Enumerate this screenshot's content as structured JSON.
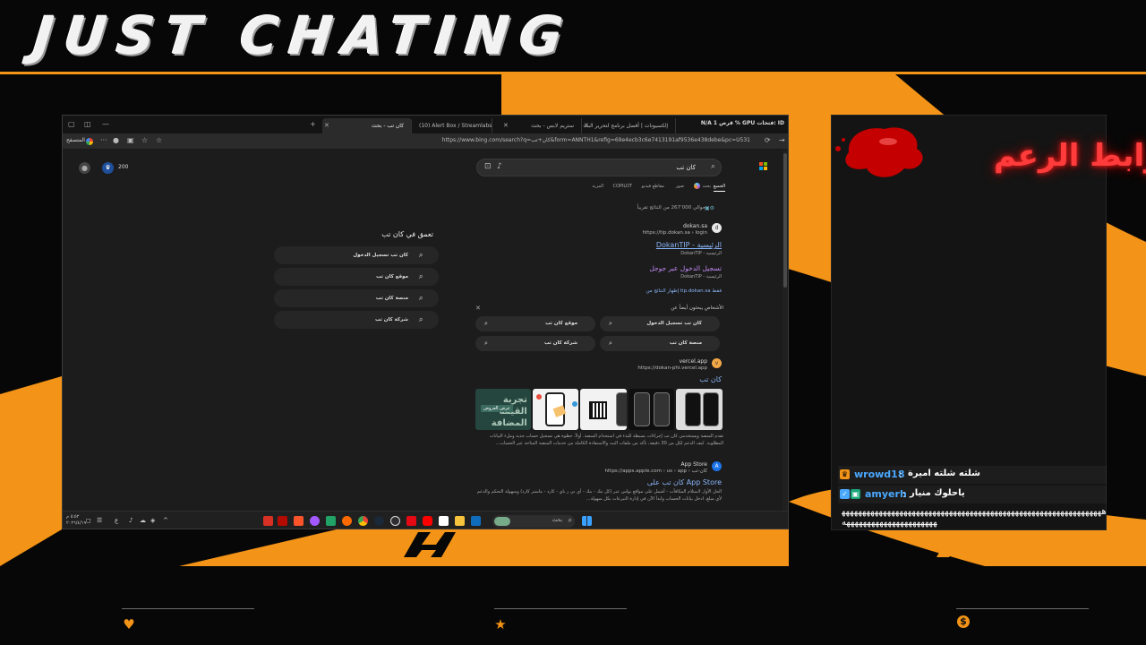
{
  "overlay": {
    "title": "JUST CHATING",
    "colors": {
      "accent": "#f39317",
      "frame": "#070707",
      "chat_name": "#4aa8ff",
      "neon": "#ff3b3b"
    },
    "footer_icons": [
      "heart-icon",
      "star-icon",
      "dollar-coin-icon"
    ],
    "dollar_symbol": "$"
  },
  "browser": {
    "tabs": [
      {
        "label": "كان تب - بحث",
        "active": true
      },
      {
        "label": "(10) Alert Box / Streamlabs",
        "active": false
      },
      {
        "label": "ستريم لابس - بحث",
        "active": false
      },
      {
        "label": "إلكسيونات | أفضل برنامج لتحرير البث",
        "active": false
      }
    ],
    "system_info": "N/A  قرص 1 % GPU فتحات: ID",
    "mode_label": "المتصفح",
    "url": "https://www.bing.com/search?q=كان+تب&form=ANNTH1&refig=69e4ecb3c6e7413191af9536e438debe&pc=U531"
  },
  "page": {
    "points": "200",
    "search_query": "كان تب",
    "scope_tabs": [
      "الجميع",
      "بحث",
      "صور",
      "مقاطع فيديو",
      "COPILOT",
      "المزيد"
    ],
    "results_count": "حوالي 267٬000 من النتائج تقريباً",
    "results": [
      {
        "favicon": "d",
        "site": "dokan.sa",
        "url": "https://tip.dokan.sa › login",
        "title": "DokanTIP - الرئيسية",
        "sub": "DokanTIP - الرئيسية",
        "title2": "تسجيل الدخول عبر جوجل",
        "sub2": "DokanTIP - الرئيسية",
        "show_all": "إظهار النتائج من tip.dokan.sa فقط"
      },
      {
        "favicon": "v",
        "site": "vercel.app",
        "url": "https://dokan-phi.vercel.app",
        "title": "كان تب",
        "snippet": "تقدم المنصة ويستخدمي كان تب إجراءات بسيطة للبدء في استخدام المنصة. أولاً، خطوة هي تسجيل حساب جديد وملء البيانات المطلوبة. كيف الدعم لكل من 30 دقيقة، تأكد من ملفات البث والاستفادة الكاملة من خدمات المنصة المتاحة عبر الحساب..."
      },
      {
        "favicon": "A",
        "site": "App Store",
        "url": "https://apps.apple.com › us › app › كان-تب",
        "title": "كان تب على App Store",
        "snippet": "الحل الأول لاستلام المكافآت - أشمل على مواقع بواس عبر (كل نبك - بنك - أي بي ر باي - كارد - ماستر كارد) وسهولة التحكم والدعم لأي مبلغ. ادخل بيانات الحساب وابدأ الآن في إدارة التبرعات بكل سهولة..."
      }
    ],
    "people_also_search": {
      "heading": "الأشخاص يبحثون أيضاً عن",
      "chips": [
        "كان تب تسجيل الدخول",
        "موقع كان تب",
        "منصة كان تب",
        "شركة كان تب"
      ]
    },
    "image_banner_text": "تجربة القيمة المضافة",
    "image_banner_small": "عرض العروض",
    "related": {
      "heading": "تعمق في كان تب",
      "items": [
        "كان تب تسجيل الدخول",
        "موقع كان تب",
        "منصة كان تب",
        "شركة كان تب"
      ]
    }
  },
  "taskbar": {
    "search_label": "بحث",
    "clock_time": "٥:٥٢ م",
    "clock_date": "٢٠٢٦/٤/١٩",
    "lang": "ع"
  },
  "side_panel": {
    "neon_label": "رابط الرعم"
  },
  "chat": {
    "messages": [
      {
        "user": "wrowd18",
        "text": "شلته شلته اميرة",
        "badge_color": "#f39317"
      },
      {
        "user": "amyerh",
        "text": "ياحلوك منيار",
        "badge_color": "#4aa8ff"
      }
    ],
    "spam_text": "ههههههههههههههههههههههههههههههههههههههههههههههههههههههههههههههههههههههههههههههههههههههه"
  }
}
